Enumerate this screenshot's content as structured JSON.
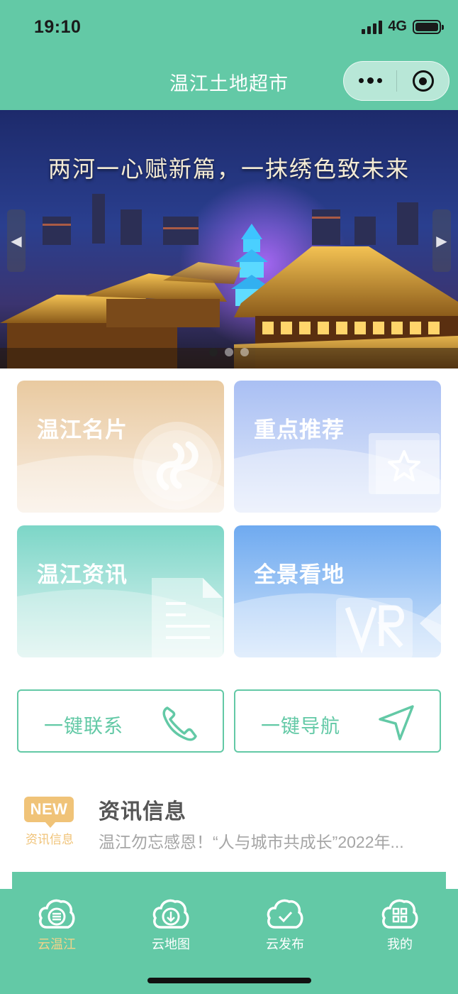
{
  "status_bar": {
    "time": "19:10",
    "network": "4G"
  },
  "nav": {
    "title": "温江土地超市"
  },
  "banner": {
    "caption": "两河一心赋新篇，一抹绣色致未来",
    "slides": 3,
    "active_slide": 1
  },
  "cards": [
    {
      "label": "温江名片",
      "icon": "mini-program-icon"
    },
    {
      "label": "重点推荐",
      "icon": "star-icon"
    },
    {
      "label": "温江资讯",
      "icon": "document-icon"
    },
    {
      "label": "全景看地",
      "icon": "vr-icon"
    }
  ],
  "actions": [
    {
      "label": "一键联系",
      "icon": "phone-icon"
    },
    {
      "label": "一键导航",
      "icon": "navigation-arrow-icon"
    }
  ],
  "news": {
    "badge": "NEW",
    "badge_sub": "资讯信息",
    "title": "资讯信息",
    "snippet": "温江勿忘感恩！“人与城市共成长”2022年..."
  },
  "tabbar": {
    "items": [
      {
        "label": "云温江",
        "icon": "cloud-list-icon",
        "active": true
      },
      {
        "label": "云地图",
        "icon": "cloud-download-icon",
        "active": false
      },
      {
        "label": "云发布",
        "icon": "cloud-check-icon",
        "active": false
      },
      {
        "label": "我的",
        "icon": "cloud-grid-icon",
        "active": false
      }
    ]
  },
  "colors": {
    "primary": "#63c9a6",
    "accent": "#f0c378",
    "active_tab": "#f2d38a"
  }
}
